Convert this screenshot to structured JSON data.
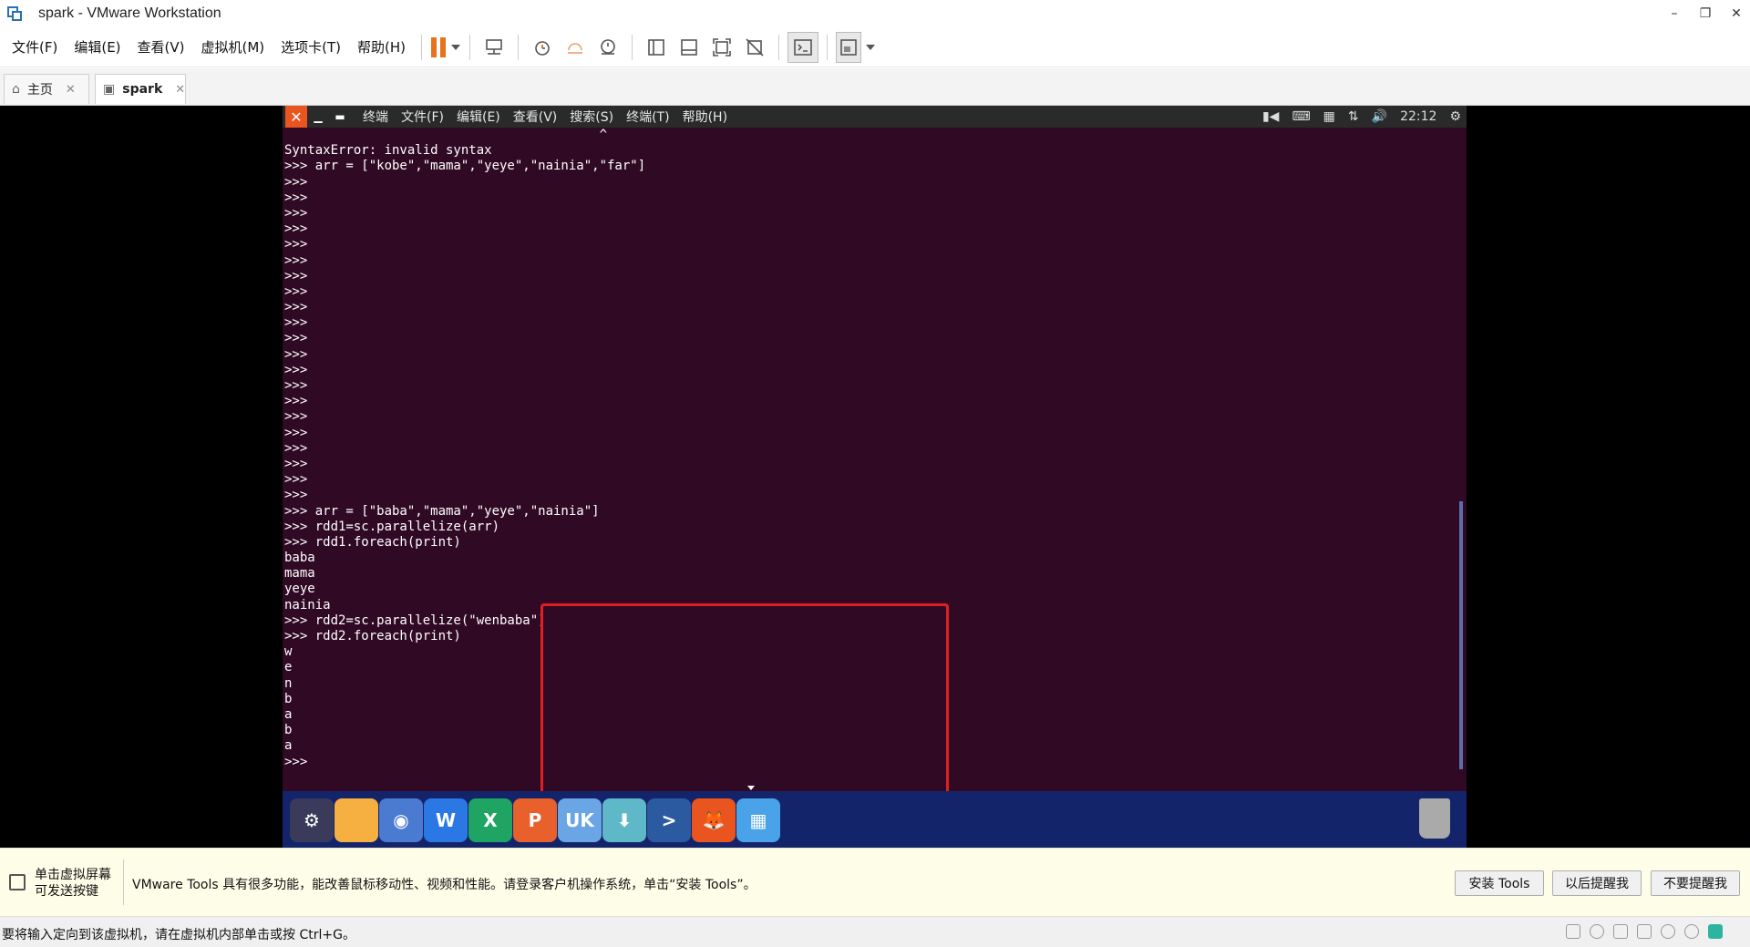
{
  "window": {
    "title": "spark - VMware Workstation",
    "minimize": "–",
    "restore": "❐",
    "close": "✕"
  },
  "menu": {
    "items": [
      "文件(F)",
      "编辑(E)",
      "查看(V)",
      "虚拟机(M)",
      "选项卡(T)",
      "帮助(H)"
    ]
  },
  "tabs": [
    {
      "label": "主页",
      "icon": "home-icon",
      "close": "✕"
    },
    {
      "label": "spark",
      "icon": "vm-icon",
      "close": "✕"
    }
  ],
  "guest": {
    "panel_menu": [
      "终端",
      "文件(F)",
      "编辑(E)",
      "查看(V)",
      "搜索(S)",
      "终端(T)",
      "帮助(H)"
    ],
    "close_glyph": "✕",
    "clock": "22:12"
  },
  "terminal": {
    "lines": [
      "                                         ^",
      "SyntaxError: invalid syntax",
      ">>> arr = [\"kobe\",\"mama\",\"yeye\",\"nainia\",\"far\"]",
      ">>>",
      ">>>",
      ">>>",
      ">>>",
      ">>>",
      ">>>",
      ">>>",
      ">>>",
      ">>>",
      ">>>",
      ">>>",
      ">>>",
      ">>>",
      ">>>",
      ">>>",
      ">>>",
      ">>>",
      ">>>",
      ">>>",
      ">>>",
      ">>>",
      ">>> arr = [\"baba\",\"mama\",\"yeye\",\"nainia\"]",
      ">>> rdd1=sc.parallelize(arr)",
      ">>> rdd1.foreach(print)",
      "baba",
      "mama",
      "yeye",
      "nainia",
      ">>> rdd2=sc.parallelize(\"wenbaba\")",
      ">>> rdd2.foreach(print)",
      "w",
      "e",
      "n",
      "b",
      "a",
      "b",
      "a",
      ">>>"
    ]
  },
  "dock": {
    "items": [
      {
        "name": "settings-app",
        "glyph": "⚙",
        "color": "#3a3a5a"
      },
      {
        "name": "files-app",
        "glyph": "",
        "color": "#f5b041"
      },
      {
        "name": "browser-app",
        "glyph": "◉",
        "color": "#4a7bd0"
      },
      {
        "name": "wps-writer-app",
        "glyph": "W",
        "color": "#2b78e4"
      },
      {
        "name": "wps-spreadsheet-app",
        "glyph": "X",
        "color": "#1fa463"
      },
      {
        "name": "wps-presentation-app",
        "glyph": "P",
        "color": "#e8602c"
      },
      {
        "name": "ukylin-app",
        "glyph": "UK",
        "color": "#6aa6e6"
      },
      {
        "name": "installer-app",
        "glyph": "⬇",
        "color": "#5fb8c8"
      },
      {
        "name": "terminal-app",
        "glyph": ">",
        "color": "#2c5aa0"
      },
      {
        "name": "firefox-app",
        "glyph": "🦊",
        "color": "#e9541f"
      },
      {
        "name": "workspace-app",
        "glyph": "▦",
        "color": "#4aa3e8"
      }
    ],
    "trash": "trash-icon"
  },
  "notification": {
    "hint_line1": "单击虚拟屏幕",
    "hint_line2": "可发送按键",
    "message": "VMware Tools 具有很多功能，能改善鼠标移动性、视频和性能。请登录客户机操作系统，单击“安装 Tools”。",
    "install_label": "安装 Tools",
    "remind_label": "以后提醒我",
    "never_label": "不要提醒我"
  },
  "status": {
    "text": "要将输入定向到该虚拟机，请在虚拟机内部单击或按 Ctrl+G。"
  },
  "colors": {
    "terminal_bg": "#300a24",
    "dock_bg": "#14246a",
    "highlight": "#e02020",
    "accent": "#e8711b"
  }
}
